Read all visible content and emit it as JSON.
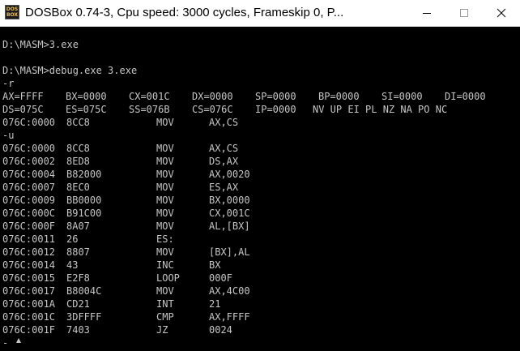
{
  "window": {
    "title": "DOSBox 0.74-3, Cpu speed:     3000 cycles, Frameskip  0, P...",
    "icon_text": "DOS BOX",
    "buttons": [
      "minimize-icon",
      "maximize-icon",
      "close-icon"
    ]
  },
  "console": {
    "lines_top": [
      "D:\\MASM>3.exe",
      "",
      "D:\\MASM>debug.exe 3.exe",
      "-r"
    ],
    "regs1": [
      "AX=FFFF",
      "BX=0000",
      "CX=001C",
      "DX=0000",
      "SP=0000",
      "BP=0000",
      "SI=0000",
      "DI=0000"
    ],
    "regs2": [
      "DS=075C",
      "ES=075C",
      "SS=076B",
      "CS=076C",
      "IP=0000"
    ],
    "flags": "NV UP EI PL NZ NA PO NC",
    "r_instr": {
      "addr": "076C:0000",
      "bytes": "8CC8",
      "mnem": "MOV",
      "ops": "AX,CS"
    },
    "u_cmd": "-u",
    "disasm": [
      {
        "addr": "076C:0000",
        "bytes": "8CC8",
        "mnem": "MOV",
        "ops": "AX,CS"
      },
      {
        "addr": "076C:0002",
        "bytes": "8ED8",
        "mnem": "MOV",
        "ops": "DS,AX"
      },
      {
        "addr": "076C:0004",
        "bytes": "B82000",
        "mnem": "MOV",
        "ops": "AX,0020"
      },
      {
        "addr": "076C:0007",
        "bytes": "8EC0",
        "mnem": "MOV",
        "ops": "ES,AX"
      },
      {
        "addr": "076C:0009",
        "bytes": "BB0000",
        "mnem": "MOV",
        "ops": "BX,0000"
      },
      {
        "addr": "076C:000C",
        "bytes": "B91C00",
        "mnem": "MOV",
        "ops": "CX,001C"
      },
      {
        "addr": "076C:000F",
        "bytes": "8A07",
        "mnem": "MOV",
        "ops": "AL,[BX]"
      },
      {
        "addr": "076C:0011",
        "bytes": "26",
        "mnem": "ES:",
        "ops": ""
      },
      {
        "addr": "076C:0012",
        "bytes": "8807",
        "mnem": "MOV",
        "ops": "[BX],AL"
      },
      {
        "addr": "076C:0014",
        "bytes": "43",
        "mnem": "INC",
        "ops": "BX"
      },
      {
        "addr": "076C:0015",
        "bytes": "E2F8",
        "mnem": "LOOP",
        "ops": "000F"
      },
      {
        "addr": "076C:0017",
        "bytes": "B8004C",
        "mnem": "MOV",
        "ops": "AX,4C00"
      },
      {
        "addr": "076C:001A",
        "bytes": "CD21",
        "mnem": "INT",
        "ops": "21"
      },
      {
        "addr": "076C:001C",
        "bytes": "3DFFFF",
        "mnem": "CMP",
        "ops": "AX,FFFF"
      },
      {
        "addr": "076C:001F",
        "bytes": "7403",
        "mnem": "JZ",
        "ops": "0024"
      }
    ],
    "prompt": "-",
    "colors": {
      "text": "#c6c6c6",
      "background": "#000000"
    }
  }
}
